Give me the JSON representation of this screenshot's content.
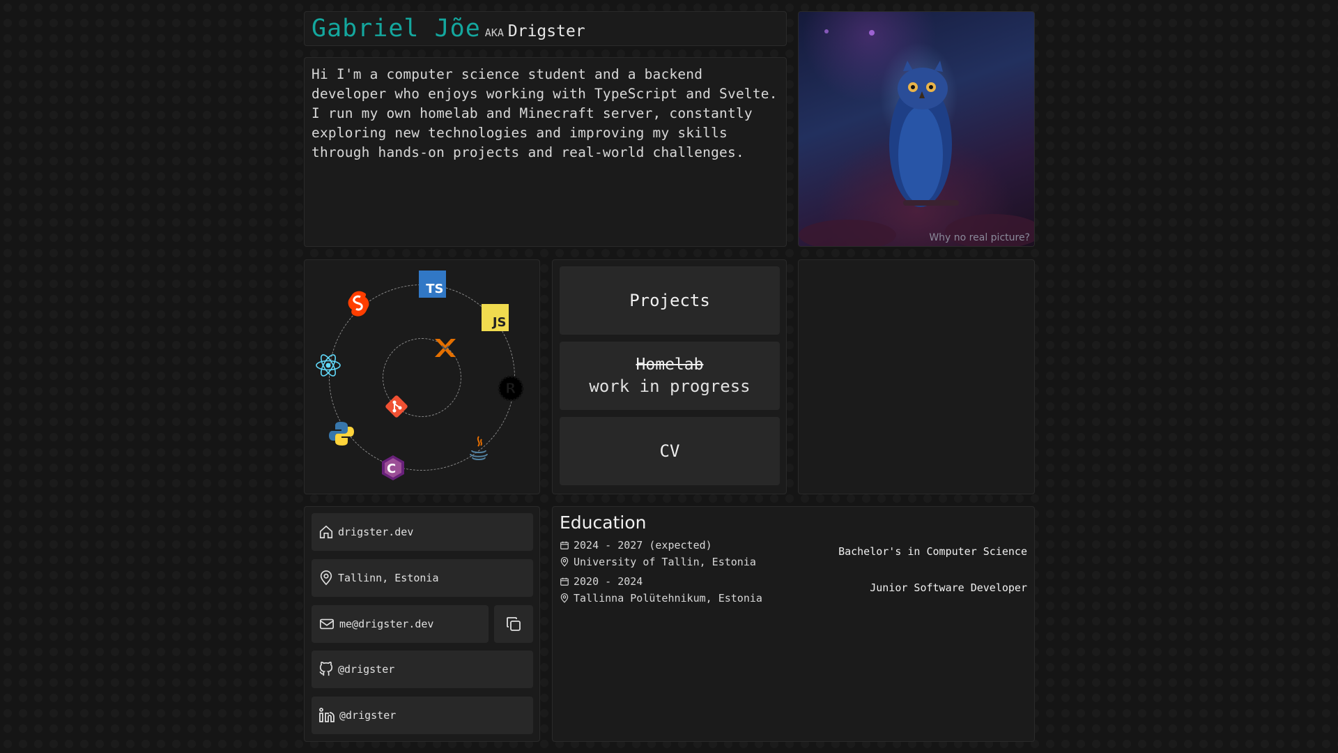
{
  "header": {
    "name": "Gabriel Jõe",
    "aka": "AKA",
    "alias": "Drigster"
  },
  "bio": "Hi I'm a computer science student and a backend developer who enjoys working with TypeScript and Svelte. I run my own homelab and Minecraft server, constantly exploring new technologies and improving my skills through hands-on projects and real-world challenges.",
  "photo": {
    "caption_link": "Why no real picture?"
  },
  "skills": {
    "outer": [
      "svelte-icon",
      "typescript-icon",
      "javascript-icon",
      "rust-icon",
      "java-icon",
      "csharp-icon",
      "python-icon",
      "react-icon"
    ],
    "inner": [
      "proxmox-icon",
      "git-icon"
    ],
    "labels": {
      "typescript": "TS",
      "javascript": "JS"
    }
  },
  "nav": {
    "projects": "Projects",
    "homelab": "Homelab",
    "homelab_status": "work in progress",
    "cv": "CV"
  },
  "contacts": {
    "website": "drigster.dev",
    "location": "Tallinn, Estonia",
    "email": "me@drigster.dev",
    "github": "@drigster",
    "linkedin": "@drigster"
  },
  "education": {
    "title": "Education",
    "entries": [
      {
        "period": "2024 - 2027 (expected)",
        "place": "University of Tallin, Estonia",
        "degree": "Bachelor's in Computer Science"
      },
      {
        "period": "2020 - 2024",
        "place": "Tallinna Polütehnikum, Estonia",
        "degree": "Junior Software Developer"
      }
    ]
  },
  "colors": {
    "accent": "#14a79e",
    "card": "#1b1b1b",
    "button": "#282828"
  }
}
